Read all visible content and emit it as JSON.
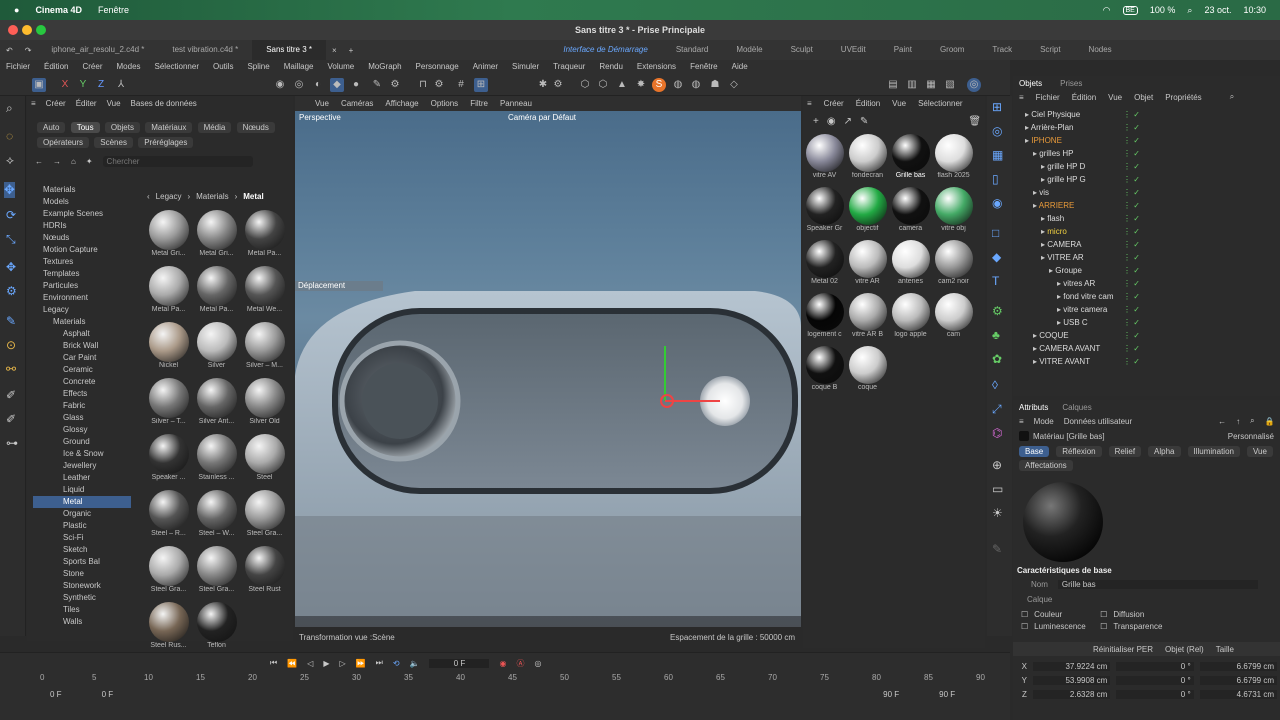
{
  "macbar": {
    "app": "Cinema 4D",
    "menu": "Fenêtre",
    "battery": "100 %",
    "date": "23 oct.",
    "time": "10:30",
    "badge": "BE"
  },
  "window": {
    "title": "Sans titre 3 * - Prise Principale"
  },
  "tabs": [
    "iphone_air_resolu_2.c4d *",
    "test vibration.c4d *",
    "Sans titre 3 *"
  ],
  "layouts": [
    "Interface de Démarrage",
    "Standard",
    "Modèle",
    "Sculpt",
    "UVEdit",
    "Paint",
    "Groom",
    "Track",
    "Script",
    "Nodes"
  ],
  "menu": [
    "Fichier",
    "Édition",
    "Créer",
    "Modes",
    "Sélectionner",
    "Outils",
    "Spline",
    "Maillage",
    "Volume",
    "MoGraph",
    "Personnage",
    "Animer",
    "Simuler",
    "Traqueur",
    "Rendu",
    "Extensions",
    "Fenêtre",
    "Aide"
  ],
  "axes": [
    "X",
    "Y",
    "Z"
  ],
  "assets": {
    "menu": [
      "Créer",
      "Éditer",
      "Vue",
      "Bases de données"
    ],
    "filters": [
      "Auto",
      "Tous",
      "Objets",
      "Matériaux",
      "Média",
      "Nœuds",
      "Opérateurs",
      "Scènes",
      "Préréglages"
    ],
    "search_placeholder": "Chercher",
    "breadcrumb": [
      "Legacy",
      "Materials",
      "Metal"
    ],
    "tree": [
      "Materials",
      "Models",
      "Example Scenes",
      "HDRIs",
      "Nœuds",
      "Motion Capture",
      "Textures",
      "Templates",
      "Particules",
      "Environment",
      "Legacy",
      "Materials",
      "Asphalt",
      "Brick Wall",
      "Car Paint",
      "Ceramic",
      "Concrete",
      "Effects",
      "Fabric",
      "Glass",
      "Glossy",
      "Ground",
      "Ice & Snow",
      "Jewellery",
      "Leather",
      "Liquid",
      "Metal",
      "Organic",
      "Plastic",
      "Sci-Fi",
      "Sketch",
      "Sports Bal",
      "Stone",
      "Stonework",
      "Synthetic",
      "Tiles",
      "Walls"
    ],
    "selected": "Metal",
    "thumbs": [
      "Metal Gri...",
      "Metal Gri...",
      "Metal Pa...",
      "Metal Pa...",
      "Metal Pa...",
      "Metal We...",
      "Nickel",
      "Silver",
      "Silver – M...",
      "Silver – T...",
      "Silver Ant...",
      "Silver Old",
      "Speaker ...",
      "Stainless ...",
      "Steel",
      "Steel – R...",
      "Steel – W...",
      "Steel Gra...",
      "Steel Gra...",
      "Steel Gra...",
      "Steel Rust",
      "Steel Rus...",
      "Teflon"
    ]
  },
  "viewport": {
    "menu": [
      "Vue",
      "Caméras",
      "Affichage",
      "Options",
      "Filtre",
      "Panneau"
    ],
    "label": "Perspective",
    "camera": "Caméra par Défaut",
    "hud": "Déplacement",
    "footer_left": "Transformation vue :Scène",
    "footer_right": "Espacement de la grille : 50000 cm"
  },
  "materials": {
    "menu": [
      "Créer",
      "Édition",
      "Vue",
      "Sélectionner"
    ],
    "items": [
      "vitre AV",
      "fondecran",
      "Grille bas",
      "flash 2025",
      "Speaker Gr",
      "objectif",
      "camera",
      "vitre obj",
      "Metal 02",
      "vitre AR",
      "antenes",
      "cam2 noir",
      "logement c",
      "vitre AR B",
      "logo apple",
      "cam",
      "coque B",
      "coque"
    ],
    "selected": "Grille bas"
  },
  "objects": {
    "tabs": [
      "Objets",
      "Prises"
    ],
    "menu": [
      "Fichier",
      "Édition",
      "Vue",
      "Objet",
      "Propriétés"
    ],
    "items": [
      {
        "name": "Ciel Physique",
        "indent": 0,
        "color": "#ddd"
      },
      {
        "name": "Arrière-Plan",
        "indent": 0,
        "color": "#ddd"
      },
      {
        "name": "IPHONE",
        "indent": 0,
        "color": "#e89a3a"
      },
      {
        "name": "grilles HP",
        "indent": 1,
        "color": "#ddd"
      },
      {
        "name": "grille HP D",
        "indent": 2,
        "color": "#ddd"
      },
      {
        "name": "grille HP G",
        "indent": 2,
        "color": "#ddd"
      },
      {
        "name": "vis",
        "indent": 1,
        "color": "#ddd"
      },
      {
        "name": "ARRIERE",
        "indent": 1,
        "color": "#e89a3a"
      },
      {
        "name": "flash",
        "indent": 2,
        "color": "#ddd"
      },
      {
        "name": "micro",
        "indent": 2,
        "color": "#f0d040"
      },
      {
        "name": "CAMERA",
        "indent": 2,
        "color": "#ddd"
      },
      {
        "name": "VITRE AR",
        "indent": 2,
        "color": "#ddd"
      },
      {
        "name": "Groupe",
        "indent": 3,
        "color": "#ddd"
      },
      {
        "name": "vitres AR",
        "indent": 4,
        "color": "#ddd"
      },
      {
        "name": "fond vitre cam",
        "indent": 4,
        "color": "#ddd"
      },
      {
        "name": "vitre camera",
        "indent": 4,
        "color": "#ddd"
      },
      {
        "name": "USB C",
        "indent": 4,
        "color": "#ddd"
      },
      {
        "name": "COQUE",
        "indent": 1,
        "color": "#ddd"
      },
      {
        "name": "CAMERA AVANT",
        "indent": 1,
        "color": "#ddd"
      },
      {
        "name": "VITRE AVANT",
        "indent": 1,
        "color": "#ddd"
      }
    ]
  },
  "attributes": {
    "tabs": [
      "Attributs",
      "Calques"
    ],
    "mode": "Mode",
    "mode2": "Données utilisateur",
    "material": "Matériau [Grille bas]",
    "custom": "Personnalisé",
    "subtabs": [
      "Base",
      "Réflexion",
      "Relief",
      "Alpha",
      "Illumination",
      "Vue"
    ],
    "affect": "Affectations",
    "section": "Caractéristiques de base",
    "name_label": "Nom",
    "name_value": "Grille bas",
    "layer_label": "Calque",
    "channels": [
      "Couleur",
      "Diffusion",
      "Luminescence",
      "Transparence"
    ]
  },
  "coords": {
    "reset": "Réinitialiser PER",
    "mode": "Objet (Rel)",
    "size": "Taille",
    "rows": [
      {
        "axis": "X",
        "pos": "37.9224 cm",
        "rot": "0 °",
        "size": "6.6799 cm"
      },
      {
        "axis": "Y",
        "pos": "53.9908 cm",
        "rot": "0 °",
        "size": "6.6799 cm"
      },
      {
        "axis": "Z",
        "pos": "2.6328 cm",
        "rot": "0 °",
        "size": "4.6731 cm"
      }
    ]
  },
  "timeline": {
    "frame": "0 F",
    "ticks": [
      "0",
      "5",
      "10",
      "15",
      "20",
      "25",
      "30",
      "35",
      "40",
      "45",
      "50",
      "55",
      "60",
      "65",
      "70",
      "75",
      "80",
      "85",
      "90"
    ],
    "start": "0 F",
    "start2": "0 F",
    "end": "90 F",
    "end2": "90 F"
  }
}
